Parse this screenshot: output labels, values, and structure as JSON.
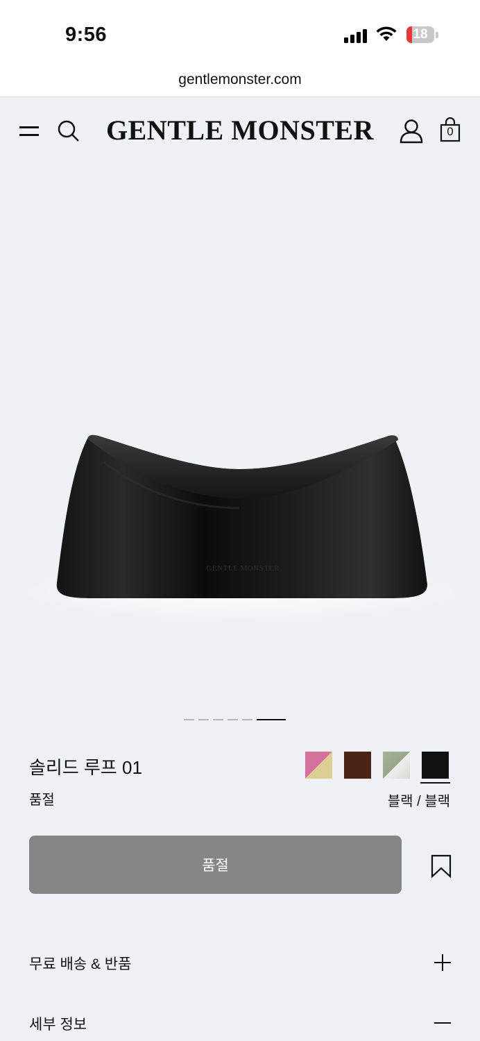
{
  "status_bar": {
    "time": "9:56",
    "battery": "18"
  },
  "browser": {
    "url": "gentlemonster.com"
  },
  "header": {
    "logo": "GENTLE MONSTER",
    "cart_count": "0"
  },
  "gallery": {
    "pages": 6,
    "active_page": 6,
    "product_brand_emboss": "GENTLE MONSTER"
  },
  "product": {
    "name": "솔리드 루프 01",
    "status": "품절",
    "selected_color": "블랙 / 블랙",
    "swatches": [
      {
        "name": "pink-yellow",
        "colors": [
          "#d6729e",
          "#ddcf93"
        ]
      },
      {
        "name": "brown",
        "colors": [
          "#4a2515"
        ]
      },
      {
        "name": "green-silver",
        "colors": [
          "#a4b393",
          "#e9e9e7"
        ]
      },
      {
        "name": "black",
        "colors": [
          "#111111"
        ],
        "selected": true
      }
    ],
    "cta_label": "품절"
  },
  "accordions": [
    {
      "label": "무료 배송 & 반품",
      "expanded": false
    },
    {
      "label": "세부 정보",
      "expanded": true
    }
  ]
}
